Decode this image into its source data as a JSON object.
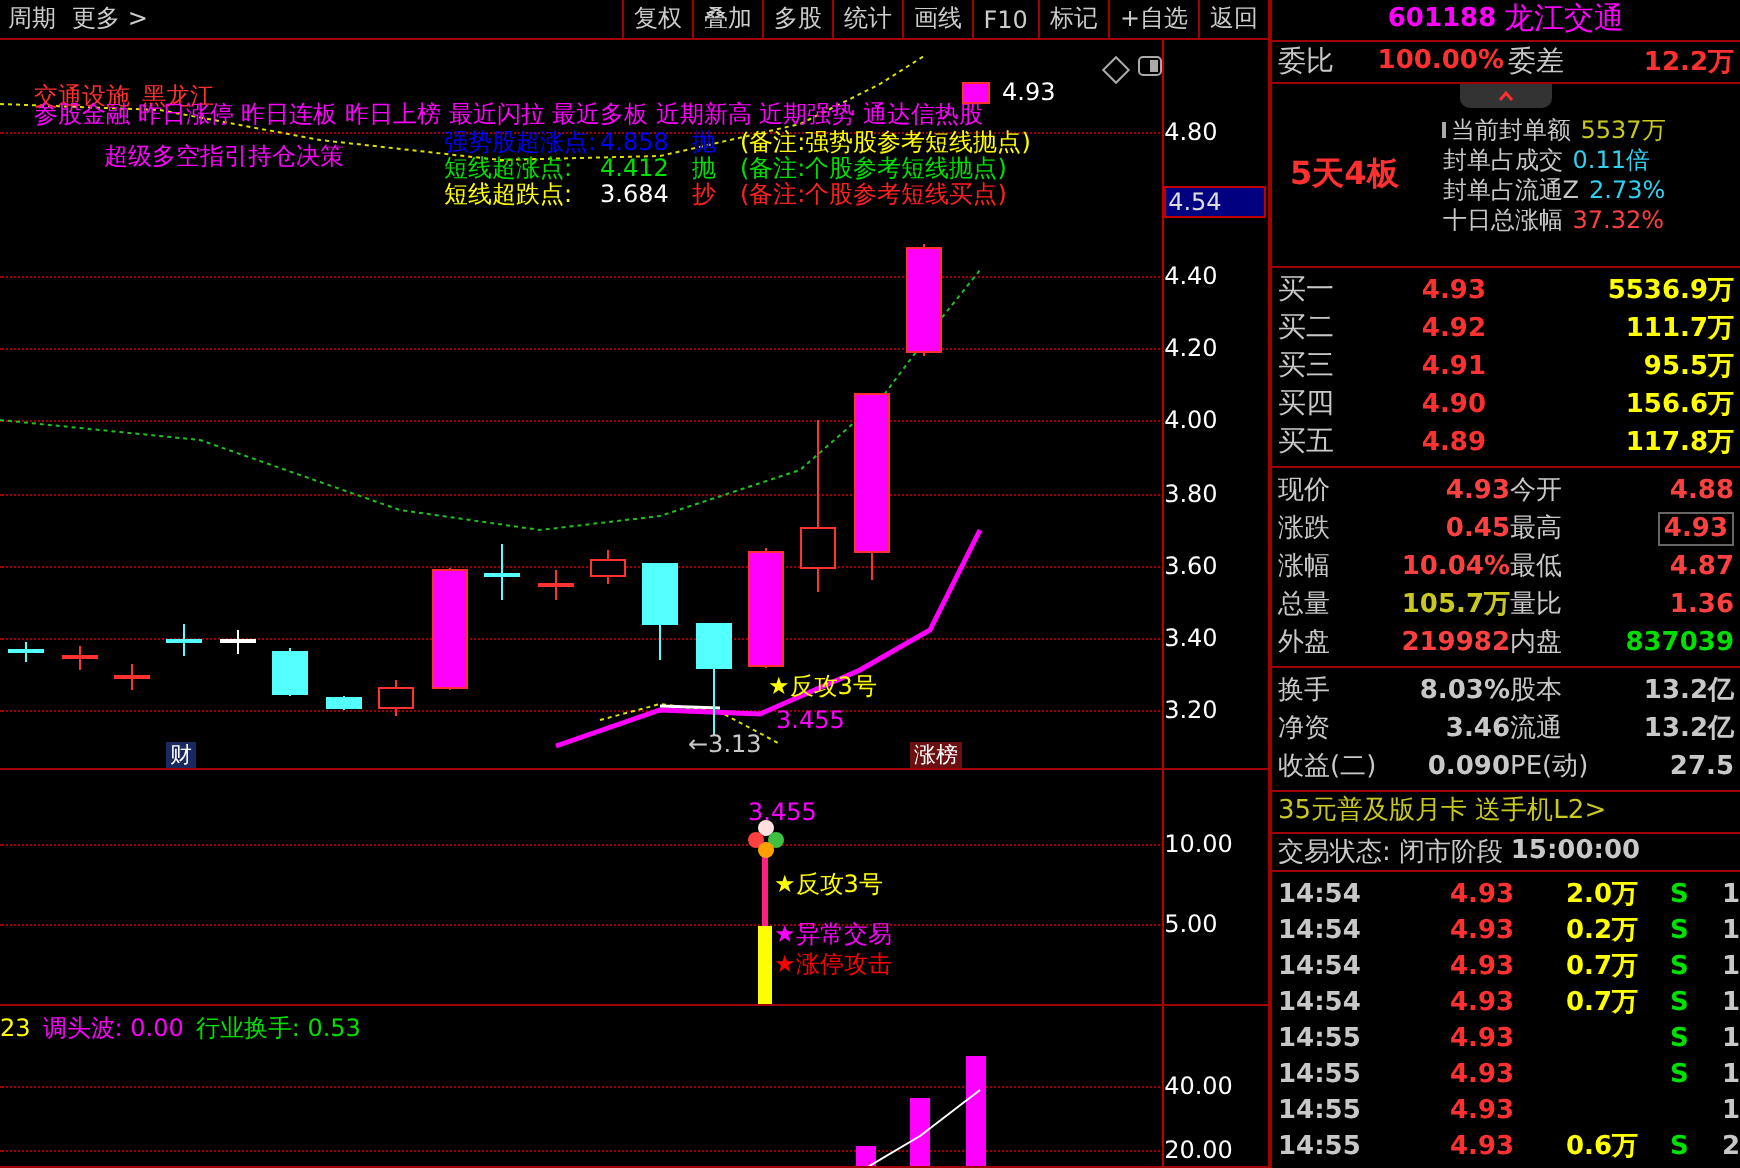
{
  "toolbar": {
    "left": [
      "周期",
      "更多 >"
    ],
    "buttons": [
      "复权",
      "叠加",
      "多股",
      "统计",
      "画线",
      "F10",
      "标记",
      "+自选",
      "返回"
    ]
  },
  "main_chart": {
    "sector": "交通设施",
    "region": "黑龙江",
    "concepts": "参股金融 昨日涨停 昨日连板 昨日上榜 最近闪拉 最近多板 近期新高 近期强势 通达信热股",
    "indicator_title": "超级多空指引持仓决策",
    "signals": [
      {
        "label": "强势股超涨点:",
        "value": "4.858",
        "action": "抛",
        "note": "(备注:强势股参考短线抛点)",
        "color": "#0000ff"
      },
      {
        "label": "短线超涨点:",
        "value": "4.412",
        "action": "抛",
        "note": "(备注:个股参考短线抛点)",
        "color": "#00e000"
      },
      {
        "label": "短线超跌点:",
        "value": "3.684",
        "action": "抄",
        "note": "(备注:个股参考短线买点)",
        "color": "#ffff00"
      }
    ],
    "high_marker": "4.93",
    "low_marker": "←3.13",
    "signal_mark": "★反攻3号",
    "line_value": "3.455",
    "badges": [
      "财",
      "涨榜"
    ],
    "axis": [
      "4.80",
      "4.40",
      "4.20",
      "4.00",
      "3.80",
      "3.60",
      "3.40",
      "3.20"
    ],
    "current_price": "4.54"
  },
  "sub_chart": {
    "value": "3.455",
    "marks": [
      {
        "text": "★反攻3号",
        "color": "#ffff00"
      },
      {
        "text": "★异常交易",
        "color": "#ff00ff"
      },
      {
        "text": "★涨停攻击",
        "color": "#ff0000"
      }
    ],
    "axis": [
      "10.00",
      "5.00"
    ]
  },
  "bottom_chart": {
    "values": [
      {
        "text": "23",
        "color": "#ffff00"
      },
      {
        "text": "调头波: 0.00",
        "color": "#ff00ff"
      },
      {
        "text": "行业换手: 0.53",
        "color": "#00e000"
      }
    ],
    "axis": [
      "40.00",
      "20.00"
    ]
  },
  "quote": {
    "code": "601188",
    "name": "龙江交通",
    "weibi_label": "委比",
    "weibi": "100.00%",
    "weicha_label": "委差",
    "weicha": "12.2万",
    "streak": "5天4板",
    "seal_info": [
      {
        "label": "当前封单额",
        "value": "5537万",
        "color": "#c8c820"
      },
      {
        "label": "封单占成交",
        "value": "0.11倍",
        "color": "#30d0f0"
      },
      {
        "label": "封单占流通Z",
        "value": "2.73%",
        "color": "#30d0f0"
      },
      {
        "label": "十日总涨幅",
        "value": "37.32%",
        "color": "#ff4040"
      }
    ],
    "bids": [
      {
        "label": "买一",
        "price": "4.93",
        "volume": "5536.9万"
      },
      {
        "label": "买二",
        "price": "4.92",
        "volume": "111.7万"
      },
      {
        "label": "买三",
        "price": "4.91",
        "volume": "95.5万"
      },
      {
        "label": "买四",
        "price": "4.90",
        "volume": "156.6万"
      },
      {
        "label": "买五",
        "price": "4.89",
        "volume": "117.8万"
      }
    ],
    "stats": [
      {
        "label": "现价",
        "value": "4.93",
        "color": "#ff4040",
        "boxed": false
      },
      {
        "label": "今开",
        "value": "4.88",
        "color": "#ff4040",
        "boxed": false
      },
      {
        "label": "涨跌",
        "value": "0.45",
        "color": "#ff4040",
        "boxed": false
      },
      {
        "label": "最高",
        "value": "4.93",
        "color": "#ff4040",
        "boxed": true
      },
      {
        "label": "涨幅",
        "value": "10.04%",
        "color": "#ff4040",
        "boxed": false
      },
      {
        "label": "最低",
        "value": "4.87",
        "color": "#ff4040",
        "boxed": false
      },
      {
        "label": "总量",
        "value": "105.7万",
        "color": "#c8c820",
        "boxed": false
      },
      {
        "label": "量比",
        "value": "1.36",
        "color": "#ff4040",
        "boxed": false
      },
      {
        "label": "外盘",
        "value": "219982",
        "color": "#ff4040",
        "boxed": false
      },
      {
        "label": "内盘",
        "value": "837039",
        "color": "#00e000",
        "boxed": false
      }
    ],
    "fundamentals": [
      {
        "l1": "换手",
        "v1": "8.03%",
        "l2": "股本",
        "v2": "13.2亿"
      },
      {
        "l1": "净资",
        "v1": "3.46",
        "l2": "流通",
        "v2": "13.2亿"
      },
      {
        "l1": "收益(二)",
        "v1": "0.090",
        "l2": "PE(动)",
        "v2": "27.5"
      }
    ],
    "promo": "35元普及版月卡 送手机L2>",
    "status_label": "交易状态:",
    "status": "闭市阶段",
    "status_time": "15:00:00",
    "ticks": [
      {
        "time": "14:54",
        "price": "4.93",
        "volume": "2.0万",
        "side": "S",
        "count": "1"
      },
      {
        "time": "14:54",
        "price": "4.93",
        "volume": "0.2万",
        "side": "S",
        "count": "1"
      },
      {
        "time": "14:54",
        "price": "4.93",
        "volume": "0.7万",
        "side": "S",
        "count": "1"
      },
      {
        "time": "14:54",
        "price": "4.93",
        "volume": "0.7万",
        "side": "S",
        "count": "1"
      },
      {
        "time": "14:55",
        "price": "4.93",
        "side": "S",
        "count": "1"
      },
      {
        "time": "14:55",
        "price": "4.93",
        "side": "S",
        "count": "1"
      },
      {
        "time": "14:55",
        "price": "4.93",
        "count": "1"
      },
      {
        "time": "14:55",
        "price": "4.93",
        "volume": "0.6万",
        "side": "S",
        "count": "2"
      }
    ]
  }
}
